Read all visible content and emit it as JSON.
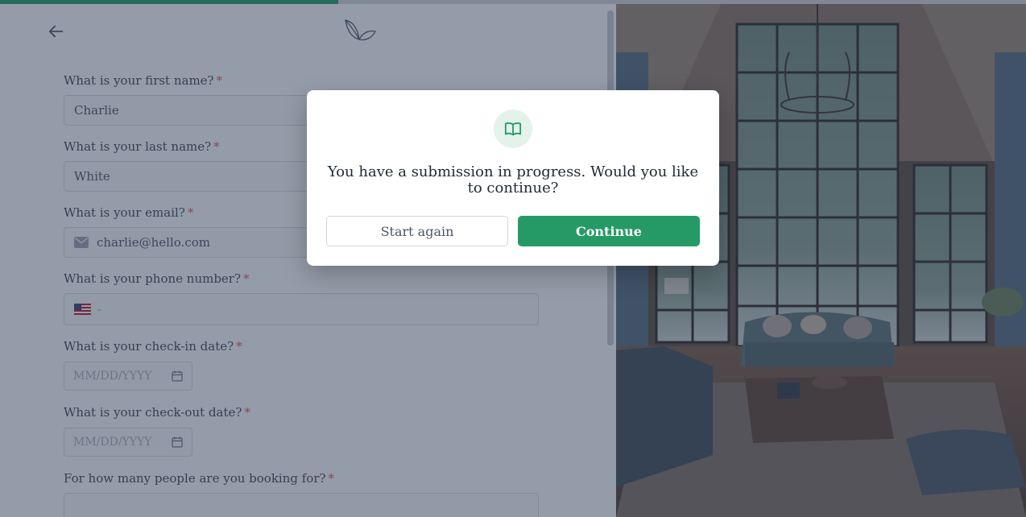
{
  "progress": {
    "fraction": 0.33,
    "color": "#259a66"
  },
  "form": {
    "questions": [
      {
        "label": "What is your first name?",
        "required_mark": "*",
        "value": "Charlie"
      },
      {
        "label": "What is your last name?",
        "required_mark": "*",
        "value": "White"
      },
      {
        "label": "What is your email?",
        "required_mark": "*",
        "value": "charlie@hello.com",
        "icon": "mail-icon"
      },
      {
        "label": "What is your phone number?",
        "required_mark": "*",
        "value": "",
        "prefix": "-",
        "icon": "us-flag-icon"
      },
      {
        "label": "What is your check-in date?",
        "required_mark": "*",
        "placeholder": "MM/DD/YYYY",
        "icon": "calendar-icon"
      },
      {
        "label": "What is your check-out date?",
        "required_mark": "*",
        "placeholder": "MM/DD/YYYY",
        "icon": "calendar-icon"
      },
      {
        "label": "For how many people are you booking for?",
        "required_mark": "*",
        "value": ""
      }
    ]
  },
  "modal": {
    "icon": "book-open-icon",
    "message": "You have a submission in progress. Would you like to continue?",
    "secondary_label": "Start again",
    "primary_label": "Continue"
  },
  "colors": {
    "accent": "#259a66",
    "required": "#e05252",
    "overlay": "rgba(43,57,84,0.50)"
  }
}
